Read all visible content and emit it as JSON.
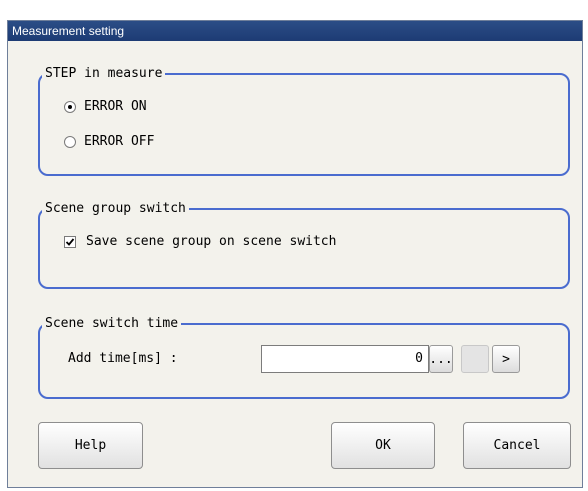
{
  "window": {
    "title": "Measurement setting"
  },
  "step_group": {
    "title": "STEP in measure",
    "options": [
      {
        "label": "ERROR ON",
        "selected": true
      },
      {
        "label": "ERROR OFF",
        "selected": false
      }
    ]
  },
  "scene_group": {
    "title": "Scene group switch",
    "checkbox_label": "Save scene group on scene switch",
    "checked": true
  },
  "switch_time": {
    "title": "Scene switch time",
    "label": "Add time[ms] :",
    "value": "0",
    "browse_label": "...",
    "next_label": ">"
  },
  "buttons": {
    "help": "Help",
    "ok": "OK",
    "cancel": "Cancel"
  },
  "colors": {
    "title_bar": "#1d3b74",
    "group_border": "#4a6ccf",
    "background": "#f3f2ec"
  }
}
